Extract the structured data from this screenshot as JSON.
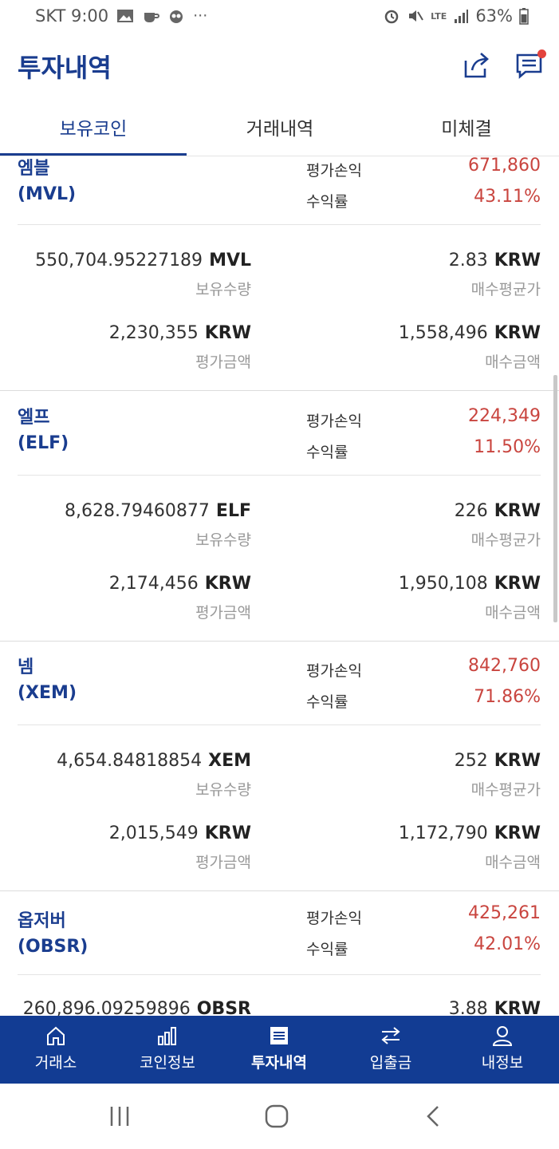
{
  "status": {
    "carrier_time": "SKT 9:00",
    "battery": "63%",
    "lte": "LTE"
  },
  "header": {
    "title": "투자내역"
  },
  "tabs": [
    {
      "label": "보유코인",
      "active": true
    },
    {
      "label": "거래내역",
      "active": false
    },
    {
      "label": "미체결",
      "active": false
    }
  ],
  "labels": {
    "pnl": "평가손익",
    "rate": "수익률",
    "holding": "보유수량",
    "avg_price": "매수평균가",
    "eval_amount": "평가금액",
    "buy_amount": "매수금액",
    "krw": "KRW"
  },
  "coins": [
    {
      "name": "엠블",
      "ticker": "(MVL)",
      "pnl": "671,860",
      "rate": "43.11%",
      "qty": "550,704.95227189",
      "qty_unit": "MVL",
      "avg": "2.83",
      "eval": "2,230,355",
      "buy": "1,558,496"
    },
    {
      "name": "엘프",
      "ticker": "(ELF)",
      "pnl": "224,349",
      "rate": "11.50%",
      "qty": "8,628.79460877",
      "qty_unit": "ELF",
      "avg": "226",
      "eval": "2,174,456",
      "buy": "1,950,108"
    },
    {
      "name": "넴",
      "ticker": "(XEM)",
      "pnl": "842,760",
      "rate": "71.86%",
      "qty": "4,654.84818854",
      "qty_unit": "XEM",
      "avg": "252",
      "eval": "2,015,549",
      "buy": "1,172,790"
    },
    {
      "name": "옵저버",
      "ticker": "(OBSR)",
      "pnl": "425,261",
      "rate": "42.01%",
      "qty": "260,896.09259896",
      "qty_unit": "OBSR",
      "avg": "3.88",
      "eval": "",
      "buy": ""
    }
  ],
  "nav": [
    {
      "label": "거래소",
      "icon": "home-icon"
    },
    {
      "label": "코인정보",
      "icon": "bar-chart-icon"
    },
    {
      "label": "투자내역",
      "icon": "document-icon",
      "active": true
    },
    {
      "label": "입출금",
      "icon": "transfer-icon"
    },
    {
      "label": "내정보",
      "icon": "user-icon"
    }
  ],
  "colors": {
    "brand": "#1a3d8f",
    "nav_bg": "#123c93",
    "profit": "#c9453f"
  }
}
